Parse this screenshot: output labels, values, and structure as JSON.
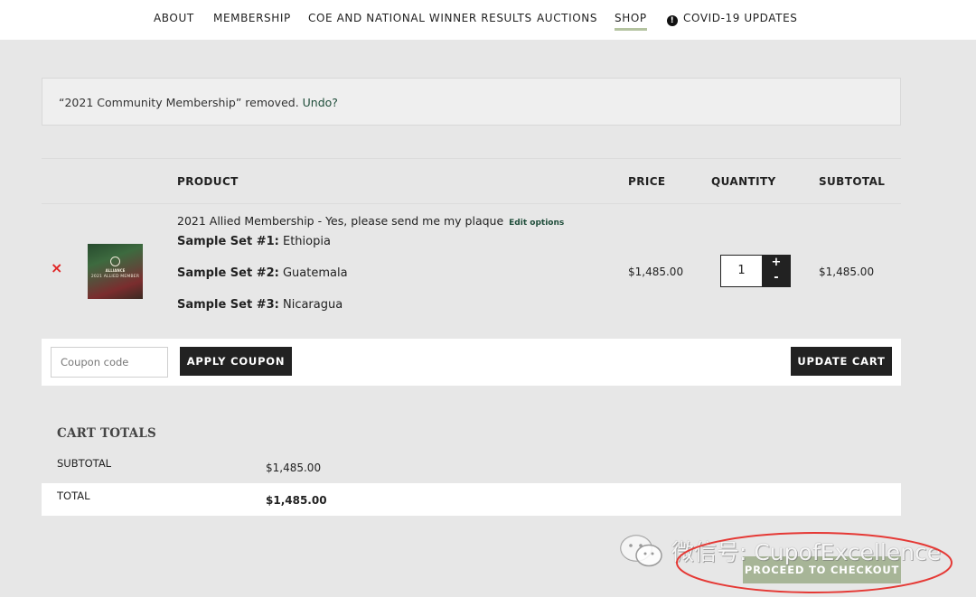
{
  "nav": {
    "items": [
      {
        "label": "ABOUT"
      },
      {
        "label": "MEMBERSHIP"
      },
      {
        "label": "COE AND NATIONAL WINNER RESULTS"
      },
      {
        "label": "AUCTIONS"
      },
      {
        "label": "SHOP",
        "active": true
      },
      {
        "label": "COVID-19 UPDATES",
        "icon": "info-icon"
      }
    ]
  },
  "notice": {
    "message": "“2021 Community Membership” removed.",
    "undo_label": "Undo?"
  },
  "cart": {
    "headers": {
      "product": "PRODUCT",
      "price": "PRICE",
      "quantity": "QUANTITY",
      "subtotal": "SUBTOTAL"
    },
    "item": {
      "remove_icon": "close-icon",
      "remove_symbol": "×",
      "thumb_caption": "2021 ALLIED MEMBER",
      "thumb_brand": "ALLIANCE",
      "name": "2021 Allied Membership - Yes, please send me my plaque",
      "edit_label": "Edit options",
      "meta": [
        {
          "key": "Sample Set #1:",
          "value": "Ethiopia"
        },
        {
          "key": "Sample Set #2:",
          "value": "Guatemala"
        },
        {
          "key": "Sample Set #3:",
          "value": "Nicaragua"
        }
      ],
      "price": "$1,485.00",
      "quantity": "1",
      "plus": "+",
      "minus": "-",
      "subtotal": "$1,485.00"
    }
  },
  "actions": {
    "coupon_placeholder": "Coupon code",
    "apply_label": "APPLY COUPON",
    "update_label": "UPDATE CART"
  },
  "totals": {
    "title": "CART TOTALS",
    "subtotal_label": "SUBTOTAL",
    "subtotal_value": "$1,485.00",
    "total_label": "TOTAL",
    "total_value": "$1,485.00"
  },
  "checkout": {
    "label": "PROCEED TO CHECKOUT"
  },
  "watermark": {
    "text": "微信号: CupofExcellence"
  },
  "colors": {
    "accent_green": "#a7b597",
    "nav_underline": "#b4c3a0",
    "remove_red": "#e02424",
    "highlight_red": "#e53935",
    "dark_button": "#222222",
    "page_bg": "#e7e7e7"
  }
}
